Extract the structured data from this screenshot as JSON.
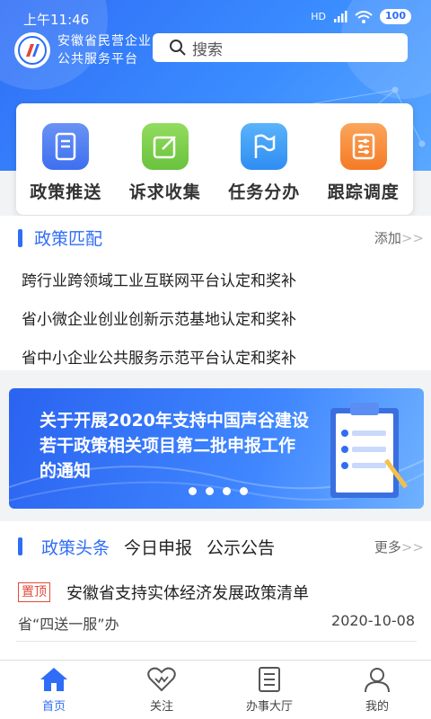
{
  "status": {
    "time": "上午11:46",
    "signal": "HD",
    "battery": "100"
  },
  "header": {
    "brand_line1": "安徽省民营企业",
    "brand_line2": "公共服务平台",
    "search_placeholder": "搜索"
  },
  "quick_actions": [
    {
      "label": "政策推送",
      "icon": "document-icon",
      "color": "#4f7ff0"
    },
    {
      "label": "诉求收集",
      "icon": "edit-icon",
      "color": "#7ccf4e"
    },
    {
      "label": "任务分办",
      "icon": "flag-icon",
      "color": "#3fa0f5"
    },
    {
      "label": "跟踪调度",
      "icon": "sliders-icon",
      "color": "#f78a36"
    }
  ],
  "policy_match": {
    "title": "政策匹配",
    "more": "添加",
    "more_arrow": ">>",
    "items": [
      "跨行业跨领域工业互联网平台认定和奖补",
      "省小微企业创业创新示范基地认定和奖补",
      "省中小企业公共服务示范平台认定和奖补"
    ]
  },
  "banner": {
    "text": "关于开展2020年支持中国声谷建设若干政策相关项目第二批申报工作的通知",
    "slide_count": 4
  },
  "news": {
    "tabs": [
      "政策头条",
      "今日申报",
      "公示公告"
    ],
    "active_tab": 0,
    "more": "更多",
    "more_arrow": ">>",
    "item": {
      "tag": "置顶",
      "title": "安徽省支持实体经济发展政策清单",
      "source": "省“四送一服”办",
      "date": "2020-10-08"
    }
  },
  "bottom_nav": [
    {
      "label": "首页",
      "icon": "home-icon",
      "active": true
    },
    {
      "label": "关注",
      "icon": "heart-icon",
      "active": false
    },
    {
      "label": "办事大厅",
      "icon": "service-hall-icon",
      "active": false
    },
    {
      "label": "我的",
      "icon": "user-icon",
      "active": false
    }
  ],
  "colors": {
    "primary": "#2f6df6",
    "tag_red": "#e24a3a"
  }
}
